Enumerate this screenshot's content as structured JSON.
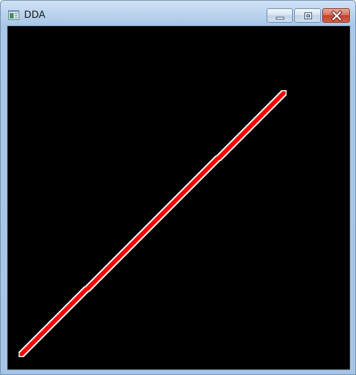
{
  "window": {
    "title": "DDA",
    "app_icon": "window-app-icon",
    "controls": {
      "minimize_icon": "minimize-icon",
      "maximize_icon": "maximize-icon",
      "close_icon": "close-icon"
    }
  },
  "canvas": {
    "background": "#000000",
    "line": {
      "algorithm": "DDA",
      "color": "#ff0000",
      "outline_color": "#ffffff"
    }
  }
}
